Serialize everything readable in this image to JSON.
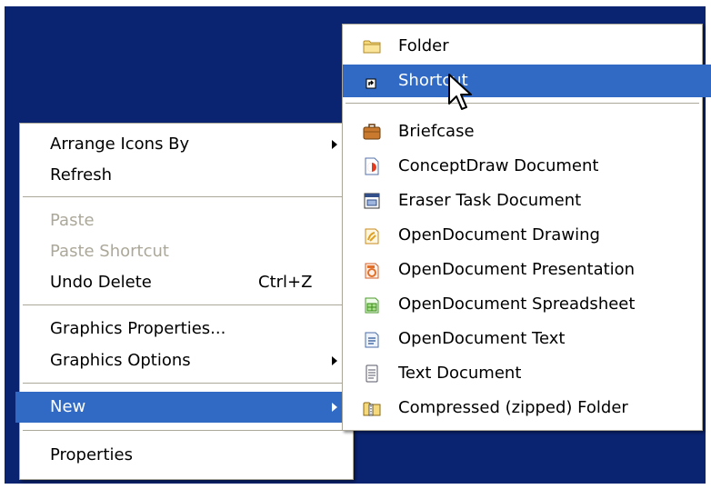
{
  "context_menu": {
    "items": [
      {
        "label": "Arrange Icons By"
      },
      {
        "label": "Refresh"
      },
      {
        "label": "Paste"
      },
      {
        "label": "Paste Shortcut"
      },
      {
        "label": "Undo Delete",
        "shortcut": "Ctrl+Z"
      },
      {
        "label": "Graphics Properties..."
      },
      {
        "label": "Graphics Options"
      },
      {
        "label": "New"
      },
      {
        "label": "Properties"
      }
    ]
  },
  "new_submenu": {
    "items": [
      {
        "label": "Folder",
        "icon": "folder-icon"
      },
      {
        "label": "Shortcut",
        "icon": "shortcut-icon"
      },
      {
        "label": "Briefcase",
        "icon": "briefcase-icon"
      },
      {
        "label": "ConceptDraw Document",
        "icon": "conceptdraw-icon"
      },
      {
        "label": "Eraser Task Document",
        "icon": "eraser-task-icon"
      },
      {
        "label": "OpenDocument Drawing",
        "icon": "odf-drawing-icon"
      },
      {
        "label": "OpenDocument Presentation",
        "icon": "odf-presentation-icon"
      },
      {
        "label": "OpenDocument Spreadsheet",
        "icon": "odf-spreadsheet-icon"
      },
      {
        "label": "OpenDocument Text",
        "icon": "odf-text-icon"
      },
      {
        "label": "Text Document",
        "icon": "text-document-icon"
      },
      {
        "label": "Compressed (zipped) Folder",
        "icon": "zip-folder-icon"
      }
    ]
  },
  "colors": {
    "desktop": "#0a2472",
    "highlight": "#316ac5",
    "disabled_text": "#aca899"
  }
}
